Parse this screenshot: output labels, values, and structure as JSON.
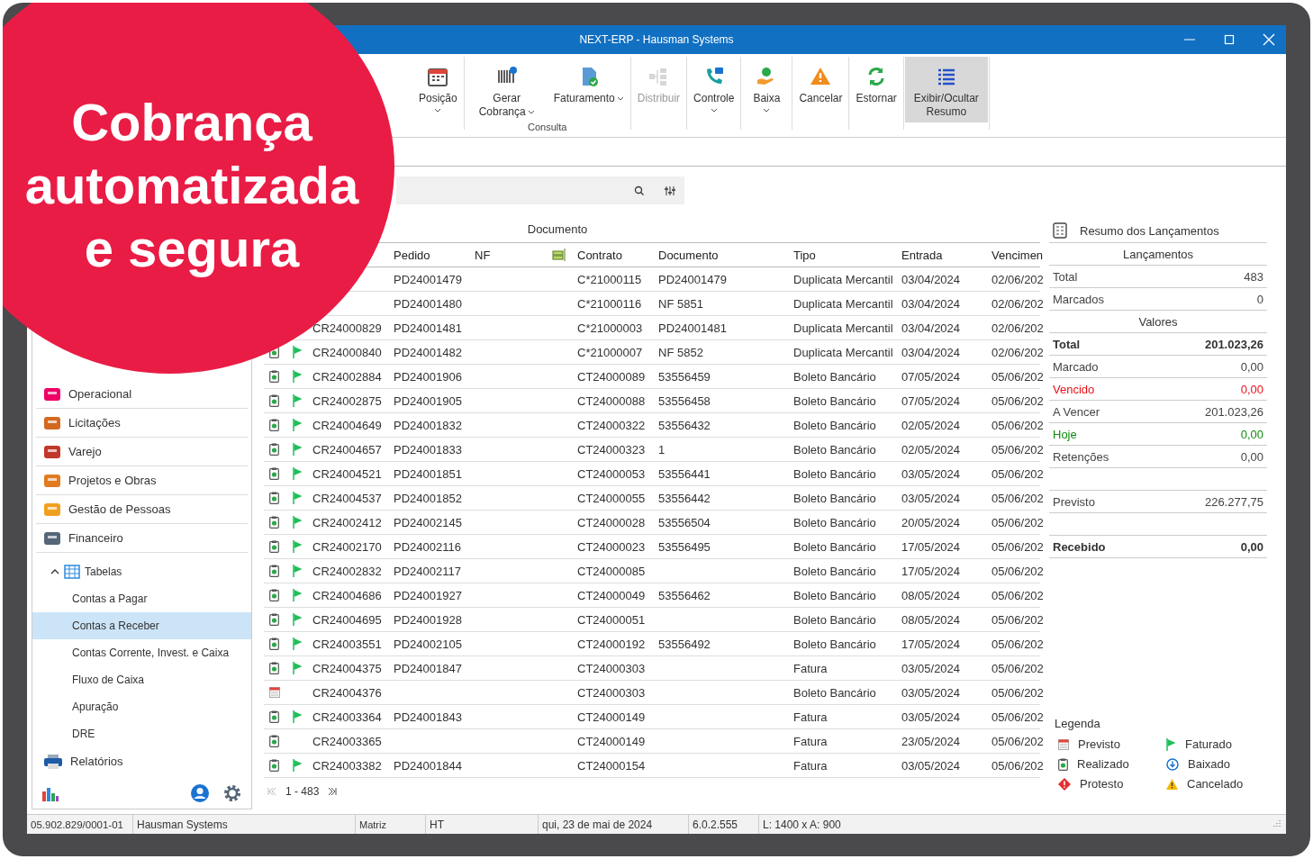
{
  "promo": {
    "headline": "Cobrança automatizada e segura"
  },
  "window": {
    "title": "NEXT-ERP - Hausman Systems"
  },
  "ribbon": {
    "groups": [
      {
        "buttons": [
          {
            "label": "Posição",
            "caret": true,
            "disabled": false,
            "selected": false
          }
        ]
      },
      {
        "label": "Consulta",
        "buttons": [
          {
            "label": "Gerar Cobrança",
            "caret": true,
            "disabled": false,
            "selected": false
          },
          {
            "label": "Faturamento",
            "caret": true,
            "disabled": false,
            "selected": false
          }
        ]
      },
      {
        "buttons": [
          {
            "label": "Distribuir",
            "caret": false,
            "disabled": true,
            "selected": false
          }
        ]
      },
      {
        "buttons": [
          {
            "label": "Controle",
            "caret": true,
            "disabled": false,
            "selected": false
          }
        ]
      },
      {
        "buttons": [
          {
            "label": "Baixa",
            "caret": true,
            "disabled": false,
            "selected": false
          }
        ]
      },
      {
        "buttons": [
          {
            "label": "Cancelar",
            "caret": false,
            "disabled": false,
            "selected": false
          }
        ]
      },
      {
        "buttons": [
          {
            "label": "Estornar",
            "caret": false,
            "disabled": false,
            "selected": false
          }
        ]
      },
      {
        "buttons": [
          {
            "label": "Exibir/Ocultar Resumo",
            "caret": false,
            "disabled": false,
            "selected": true
          }
        ]
      }
    ]
  },
  "sidebar": {
    "modules": [
      {
        "label": "Operacional"
      },
      {
        "label": "Licitações"
      },
      {
        "label": "Varejo"
      },
      {
        "label": "Projetos e Obras"
      },
      {
        "label": "Gestão de Pessoas"
      },
      {
        "label": "Financeiro"
      }
    ],
    "tree": [
      {
        "label": "Tabelas",
        "expanded": true,
        "children": [
          {
            "label": "Contas a Pagar",
            "selected": false
          },
          {
            "label": "Contas a Receber",
            "selected": true
          },
          {
            "label": "Contas Corrente, Invest. e Caixa",
            "selected": false
          },
          {
            "label": "Fluxo de Caixa",
            "selected": false
          },
          {
            "label": "Apuração",
            "selected": false
          },
          {
            "label": "DRE",
            "selected": false
          }
        ]
      }
    ],
    "reports": "Relatórios"
  },
  "table": {
    "group_header": "Documento",
    "columns": [
      "Pedido",
      "NF",
      "Contrato",
      "Documento",
      "Tipo",
      "Entrada",
      "Vencimen"
    ],
    "rows": [
      {
        "pedido": "PD24001479",
        "contrato": "C*21000115",
        "documento": "PD24001479",
        "tipo": "Duplicata Mercantil",
        "entrada": "03/04/2024",
        "vencimento": "02/06/202"
      },
      {
        "pedido": "PD24001480",
        "contrato": "C*21000116",
        "documento": "NF 5851",
        "tipo": "Duplicata Mercantil",
        "entrada": "03/04/2024",
        "vencimento": "02/06/202"
      },
      {
        "codigo": "CR24000829",
        "pedido": "PD24001481",
        "contrato": "C*21000003",
        "documento": "PD24001481",
        "tipo": "Duplicata Mercantil",
        "entrada": "03/04/2024",
        "vencimento": "02/06/202"
      },
      {
        "kind": "realizado",
        "faturado": true,
        "codigo": "CR24000840",
        "pedido": "PD24001482",
        "contrato": "C*21000007",
        "documento": "NF 5852",
        "tipo": "Duplicata Mercantil",
        "entrada": "03/04/2024",
        "vencimento": "02/06/202"
      },
      {
        "kind": "realizado",
        "faturado": true,
        "codigo": "CR24002884",
        "pedido": "PD24001906",
        "contrato": "CT24000089",
        "documento": "53556459",
        "tipo": "Boleto Bancário",
        "entrada": "07/05/2024",
        "vencimento": "05/06/202"
      },
      {
        "kind": "realizado",
        "faturado": true,
        "codigo": "CR24002875",
        "pedido": "PD24001905",
        "contrato": "CT24000088",
        "documento": "53556458",
        "tipo": "Boleto Bancário",
        "entrada": "07/05/2024",
        "vencimento": "05/06/202"
      },
      {
        "kind": "realizado",
        "faturado": true,
        "codigo": "CR24004649",
        "pedido": "PD24001832",
        "contrato": "CT24000322",
        "documento": "53556432",
        "tipo": "Boleto Bancário",
        "entrada": "02/05/2024",
        "vencimento": "05/06/202"
      },
      {
        "kind": "realizado",
        "faturado": true,
        "codigo": "CR24004657",
        "pedido": "PD24001833",
        "contrato": "CT24000323",
        "documento": "1",
        "tipo": "Boleto Bancário",
        "entrada": "02/05/2024",
        "vencimento": "05/06/202"
      },
      {
        "kind": "realizado",
        "faturado": true,
        "codigo": "CR24004521",
        "pedido": "PD24001851",
        "contrato": "CT24000053",
        "documento": "53556441",
        "tipo": "Boleto Bancário",
        "entrada": "03/05/2024",
        "vencimento": "05/06/202"
      },
      {
        "kind": "realizado",
        "faturado": true,
        "codigo": "CR24004537",
        "pedido": "PD24001852",
        "contrato": "CT24000055",
        "documento": "53556442",
        "tipo": "Boleto Bancário",
        "entrada": "03/05/2024",
        "vencimento": "05/06/202"
      },
      {
        "kind": "realizado",
        "faturado": true,
        "codigo": "CR24002412",
        "pedido": "PD24002145",
        "contrato": "CT24000028",
        "documento": "53556504",
        "tipo": "Boleto Bancário",
        "entrada": "20/05/2024",
        "vencimento": "05/06/202"
      },
      {
        "kind": "realizado",
        "faturado": true,
        "codigo": "CR24002170",
        "pedido": "PD24002116",
        "contrato": "CT24000023",
        "documento": "53556495",
        "tipo": "Boleto Bancário",
        "entrada": "17/05/2024",
        "vencimento": "05/06/202"
      },
      {
        "kind": "realizado",
        "faturado": true,
        "codigo": "CR24002832",
        "pedido": "PD24002117",
        "contrato": "CT24000085",
        "tipo": "Boleto Bancário",
        "entrada": "17/05/2024",
        "vencimento": "05/06/202"
      },
      {
        "kind": "realizado",
        "faturado": true,
        "codigo": "CR24004686",
        "pedido": "PD24001927",
        "contrato": "CT24000049",
        "documento": "53556462",
        "tipo": "Boleto Bancário",
        "entrada": "08/05/2024",
        "vencimento": "05/06/202"
      },
      {
        "kind": "realizado",
        "faturado": true,
        "codigo": "CR24004695",
        "pedido": "PD24001928",
        "contrato": "CT24000051",
        "tipo": "Boleto Bancário",
        "entrada": "08/05/2024",
        "vencimento": "05/06/202"
      },
      {
        "kind": "realizado",
        "faturado": true,
        "codigo": "CR24003551",
        "pedido": "PD24002105",
        "contrato": "CT24000192",
        "documento": "53556492",
        "tipo": "Boleto Bancário",
        "entrada": "17/05/2024",
        "vencimento": "05/06/202"
      },
      {
        "kind": "realizado",
        "faturado": true,
        "codigo": "CR24004375",
        "pedido": "PD24001847",
        "contrato": "CT24000303",
        "tipo": "Fatura",
        "entrada": "03/05/2024",
        "vencimento": "05/06/202"
      },
      {
        "kind": "previsto",
        "faturado": false,
        "codigo": "CR24004376",
        "contrato": "CT24000303",
        "tipo": "Boleto Bancário",
        "entrada": "03/05/2024",
        "vencimento": "05/06/202"
      },
      {
        "kind": "realizado",
        "faturado": true,
        "codigo": "CR24003364",
        "pedido": "PD24001843",
        "contrato": "CT24000149",
        "tipo": "Fatura",
        "entrada": "03/05/2024",
        "vencimento": "05/06/202"
      },
      {
        "kind": "realizado",
        "faturado": false,
        "codigo": "CR24003365",
        "contrato": "CT24000149",
        "tipo": "Fatura",
        "entrada": "23/05/2024",
        "vencimento": "05/06/202"
      },
      {
        "kind": "realizado",
        "faturado": true,
        "codigo": "CR24003382",
        "pedido": "PD24001844",
        "contrato": "CT24000154",
        "tipo": "Fatura",
        "entrada": "03/05/2024",
        "vencimento": "05/06/202"
      }
    ],
    "pager": "1 - 483"
  },
  "summary": {
    "title": "Resumo dos Lançamentos",
    "items": [
      {
        "kind": "section",
        "label": "Lançamentos"
      },
      {
        "kind": "row",
        "label": "Total",
        "value": "483"
      },
      {
        "kind": "row",
        "label": "Marcados",
        "value": "0"
      },
      {
        "kind": "section",
        "label": "Valores"
      },
      {
        "kind": "strong",
        "label": "Total",
        "value": "201.023,26"
      },
      {
        "kind": "row",
        "label": "Marcado",
        "value": "0,00"
      },
      {
        "kind": "overdue",
        "label": "Vencido",
        "value": "0,00"
      },
      {
        "kind": "row",
        "label": "A Vencer",
        "value": "201.023,26"
      },
      {
        "kind": "today",
        "label": "Hoje",
        "value": "0,00"
      },
      {
        "kind": "row",
        "label": "Retenções",
        "value": "0,00"
      },
      {
        "kind": "gap"
      },
      {
        "kind": "row",
        "label": "Previsto",
        "value": "226.277,75"
      },
      {
        "kind": "gap"
      },
      {
        "kind": "strong",
        "label": "Recebido",
        "value": "0,00"
      }
    ]
  },
  "legend": {
    "title": "Legenda",
    "items": [
      {
        "label": "Previsto"
      },
      {
        "label": "Faturado"
      },
      {
        "label": "Realizado"
      },
      {
        "label": "Baixado"
      },
      {
        "label": "Protesto"
      },
      {
        "label": "Cancelado"
      }
    ]
  },
  "status_bar": [
    "05.902.829/0001-01",
    "Hausman Systems",
    "Matriz",
    "HT",
    "qui, 23 de mai de 2024",
    "6.0.2.555",
    "L: 1400 x A: 900"
  ]
}
